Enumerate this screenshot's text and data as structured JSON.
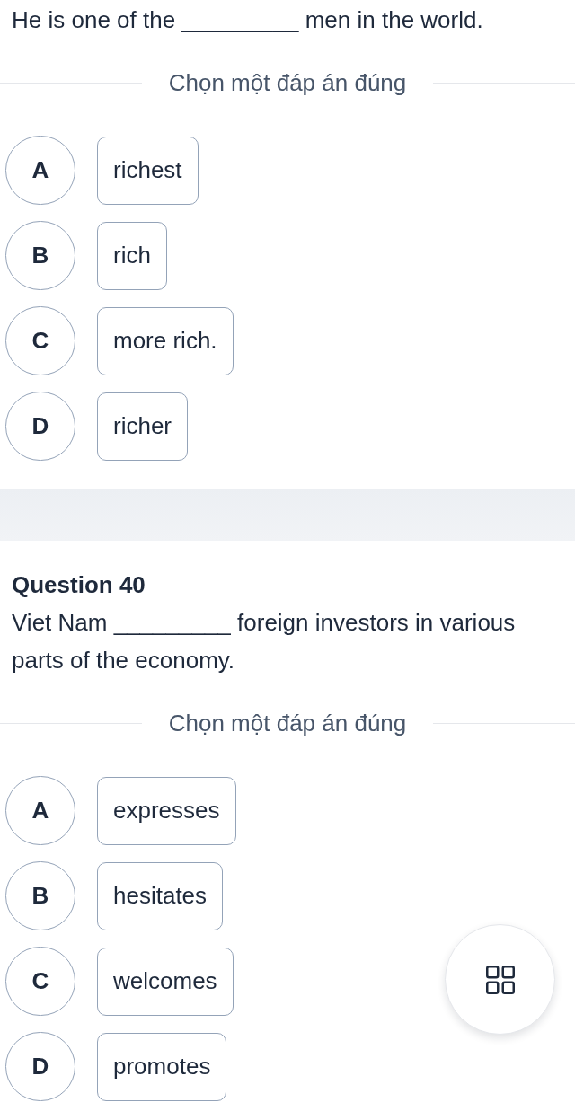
{
  "questions": [
    {
      "text": "He is one of the _________ men in the world.",
      "instruction": "Chọn một đáp án đúng",
      "options": [
        {
          "letter": "A",
          "text": "richest",
          "selected": false
        },
        {
          "letter": "B",
          "text": "rich",
          "selected": false
        },
        {
          "letter": "C",
          "text": "more rich.",
          "selected": false
        },
        {
          "letter": "D",
          "text": "richer",
          "selected": false
        }
      ]
    },
    {
      "title": "Question 40",
      "text": "Viet Nam _________ foreign investors in various parts of the economy.",
      "instruction": "Chọn một đáp án đúng",
      "options": [
        {
          "letter": "A",
          "text": "expresses",
          "selected": false
        },
        {
          "letter": "B",
          "text": "hesitates",
          "selected": false
        },
        {
          "letter": "C",
          "text": "welcomes",
          "selected": false
        },
        {
          "letter": "D",
          "text": "promotes",
          "selected": false
        }
      ]
    }
  ]
}
